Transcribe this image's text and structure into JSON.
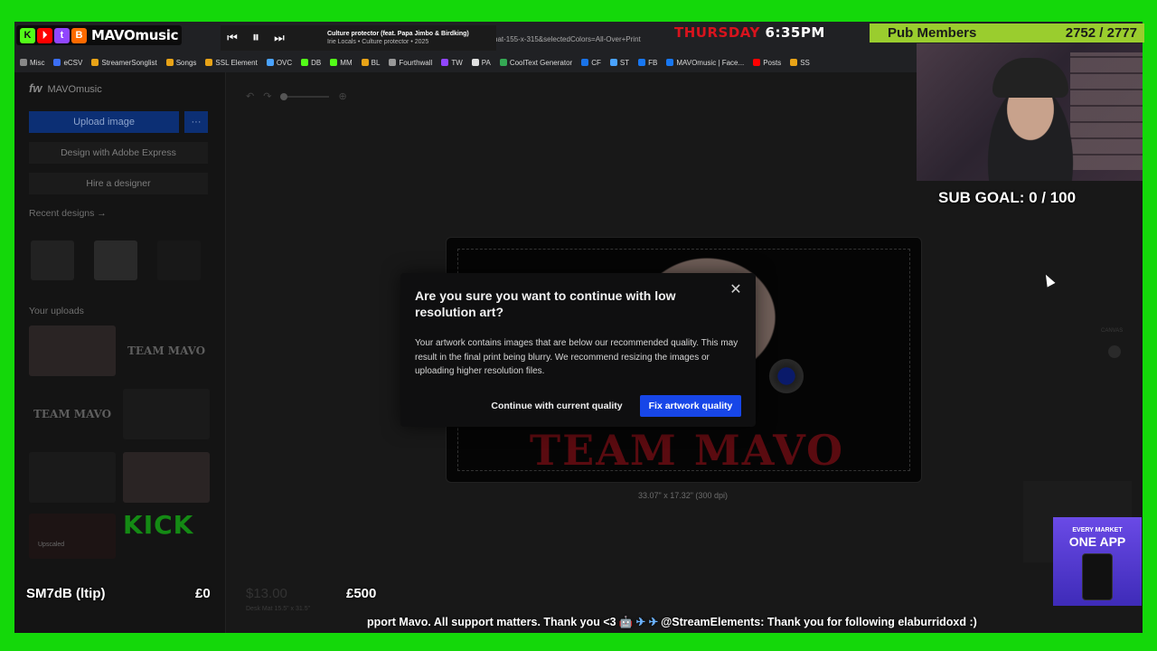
{
  "music_overlay": {
    "brand": "MAVOmusic",
    "badges": [
      {
        "label": "K",
        "color": "#53fc18"
      },
      {
        "label": "⏵",
        "color": "#ff0000"
      },
      {
        "label": "t",
        "color": "#9146ff"
      },
      {
        "label": "B",
        "color": "#ff6a00"
      }
    ],
    "song_title": "Culture protector (feat. Papa Jimbo & Birdking)",
    "song_artist": "Irie Locals • Culture protector • 2025"
  },
  "browser": {
    "url_fragment": "hat-155-x-315&selectedColors=All-Over+Print",
    "bookmarks": [
      {
        "label": "Misc",
        "color": "#888"
      },
      {
        "label": "eCSV",
        "color": "#3b6ef5"
      },
      {
        "label": "StreamerSonglist",
        "color": "#e8a317"
      },
      {
        "label": "Songs",
        "color": "#e8a317"
      },
      {
        "label": "SSL Element",
        "color": "#e8a317"
      },
      {
        "label": "OVC",
        "color": "#4aa3ff"
      },
      {
        "label": "DB",
        "color": "#53fc18"
      },
      {
        "label": "MM",
        "color": "#53fc18"
      },
      {
        "label": "BL",
        "color": "#e8a317"
      },
      {
        "label": "Fourthwall",
        "color": "#999"
      },
      {
        "label": "TW",
        "color": "#9146ff"
      },
      {
        "label": "PA",
        "color": "#e0e0e0"
      },
      {
        "label": "CoolText Generator",
        "color": "#34a853"
      },
      {
        "label": "CF",
        "color": "#1a73e8"
      },
      {
        "label": "ST",
        "color": "#4aa3ff"
      },
      {
        "label": "FB",
        "color": "#1877f2"
      },
      {
        "label": "MAVOmusic | Face...",
        "color": "#1877f2"
      },
      {
        "label": "Posts",
        "color": "#ff0000"
      },
      {
        "label": "SS",
        "color": "#e8a317"
      }
    ]
  },
  "clock": {
    "day": "THURSDAY",
    "time": "6:35PM"
  },
  "pub_members": {
    "label": "Pub Members",
    "count": "2752 / 2777"
  },
  "sub_goal": "SUB GOAL: 0 / 100",
  "editor": {
    "store_name": "MAVOmusic",
    "upload_label": "Upload image",
    "more_label": "···",
    "adobe_label": "Design with Adobe Express",
    "hire_label": "Hire a designer",
    "recent_designs": "Recent designs →",
    "your_uploads": "Your uploads",
    "upload_texts": [
      "TEAM MAVO",
      "TEAM MAVO"
    ],
    "kick_text": "KICK",
    "upscaled": "Upscaled",
    "mat_text": "TEAM MAVO",
    "dimensions": "33.07\" x 17.32\" (300 dpi)",
    "canvas_label": "CANVAS",
    "product_small": "Desk Mat 15.5\" x 31.5\""
  },
  "modal": {
    "title": "Are you sure you want to continue with low resolution art?",
    "body": "Your artwork contains images that are below our recommended quality. This may result in the final print being blurry. We recommend resizing the images or uploading higher resolution files.",
    "secondary_label": "Continue with current quality",
    "primary_label": "Fix artwork quality",
    "close_label": "✕"
  },
  "donation": {
    "name": "SM7dB (ltip)",
    "min": "£0",
    "mid": "$13.00",
    "max": "£500"
  },
  "ticker": {
    "lead": "pport Mavo. All support matters. Thank you <3",
    "emoji": "🤖 ✈ ✈",
    "tail": "@StreamElements: Thank you for following elaburridoxd :)"
  },
  "ad": {
    "line1": "EVERY MARKET",
    "line2": "ONE APP"
  }
}
